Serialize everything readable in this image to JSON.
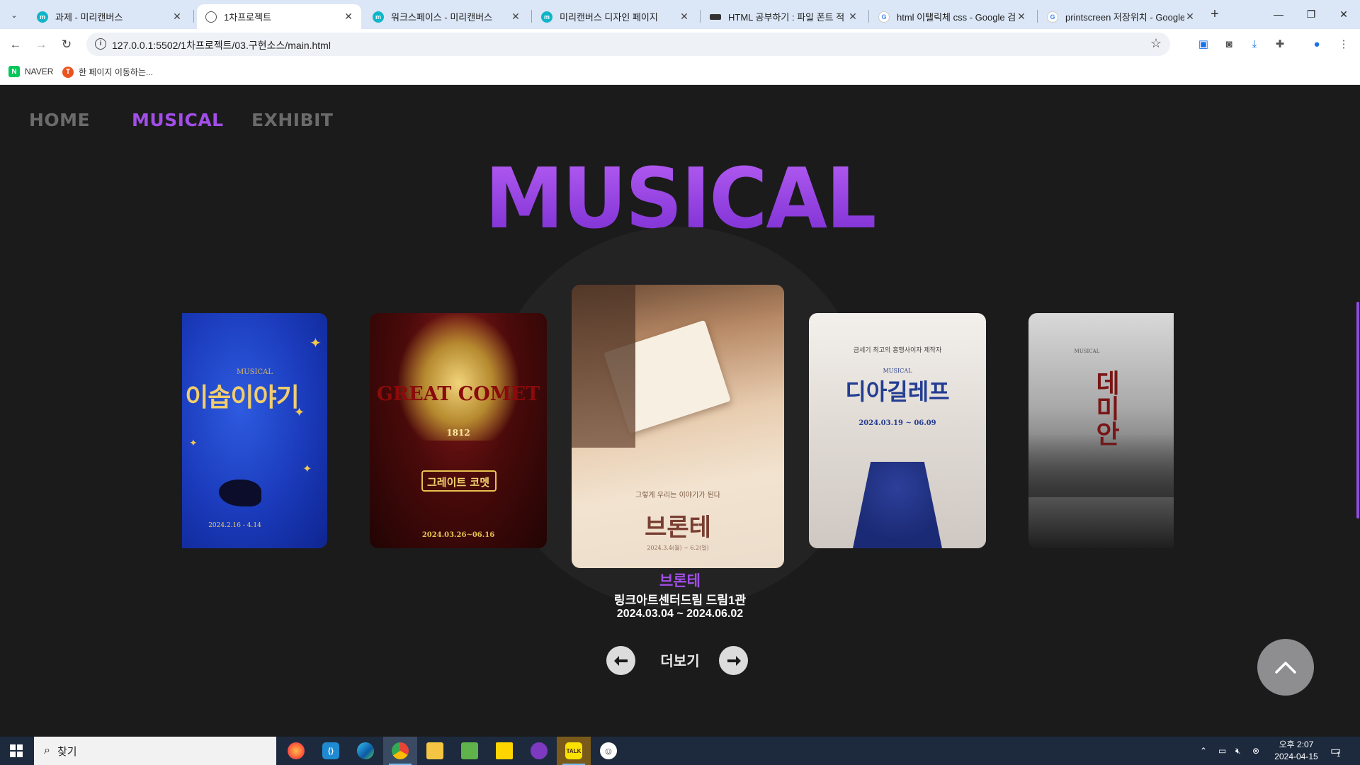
{
  "browser": {
    "tabs": [
      {
        "title": "과제 - 미리캔버스",
        "icon": "miricanvas-icon",
        "active": false
      },
      {
        "title": "1차프로젝트",
        "icon": "globe-icon",
        "active": true
      },
      {
        "title": "워크스페이스 - 미리캔버스",
        "icon": "miricanvas-icon",
        "active": false
      },
      {
        "title": "미리캔버스 디자인 페이지",
        "icon": "miricanvas-icon",
        "active": false
      },
      {
        "title": "HTML 공부하기 : 파일 폰트 적",
        "icon": "blog-icon",
        "active": false
      },
      {
        "title": "html 이탤릭체 css - Google 검",
        "icon": "google-icon",
        "active": false
      },
      {
        "title": "printscreen 저장위치 - Google",
        "icon": "google-icon",
        "active": false
      }
    ],
    "address": "127.0.0.1:5502/1차프로젝트/03.구현소스/main.html",
    "bookmarks": [
      {
        "label": "NAVER",
        "icon": "naver-icon"
      },
      {
        "label": "한 페이지 이동하는...",
        "icon": "tistory-icon"
      }
    ]
  },
  "site": {
    "nav": [
      {
        "label": "HOME",
        "active": false
      },
      {
        "label": "MUSICAL",
        "active": true
      },
      {
        "label": "EXHIBIT",
        "active": false
      }
    ],
    "section_title": "MUSICAL",
    "posters": [
      {
        "name": "poster-ihop",
        "title": "이솝이야기",
        "date_text": "2024.2.16 - 4.14"
      },
      {
        "name": "poster-great-comet",
        "title": "GREAT COMET",
        "subtitle": "그레이트 코멧",
        "year": "1812",
        "date_text": "2024.03.26~06.16"
      },
      {
        "name": "poster-bronte",
        "title": "브론테",
        "tagline": "그렇게 우리는 이야기가 된다",
        "date_text": "2024.3.4(월) ~ 6.2(일)"
      },
      {
        "name": "poster-diaghilev",
        "title": "디아길레프",
        "tagline": "금세기 최고의 흥행사이자 제작자",
        "label": "MUSICAL",
        "date_text": "2024.03.19 ~ 06.09"
      },
      {
        "name": "poster-demian",
        "title": "데미안",
        "label": "MUSICAL"
      }
    ],
    "featured": {
      "title": "브론테",
      "venue": "링크아트센터드림 드림1관",
      "dates": "2024.03.04 ~ 2024.06.02"
    },
    "more_label": "더보기"
  },
  "taskbar": {
    "search_placeholder": "찾기",
    "apps": [
      "firefox-icon",
      "vscode-icon",
      "edge-icon",
      "chrome-icon",
      "file-explorer-icon",
      "notepad-icon",
      "sticky-notes-icon",
      "github-icon",
      "kakaotalk-icon",
      "emoji-app-icon"
    ],
    "time": "오후 2:07",
    "date": "2024-04-15",
    "notification_count": "1"
  }
}
